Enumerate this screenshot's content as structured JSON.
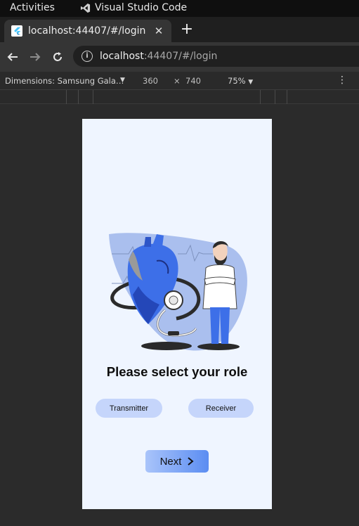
{
  "system_bar": {
    "activities": "Activities",
    "app_name": "Visual Studio Code"
  },
  "tab": {
    "title": "localhost:44407/#/login",
    "close_glyph": "✕"
  },
  "new_tab_glyph": "+",
  "address_bar": {
    "host": "localhost",
    "path": ":44407/#/login"
  },
  "devtools": {
    "device_label": "Dimensions: Samsung Gala…",
    "width": "360",
    "times": "×",
    "height": "740",
    "zoom": "75%"
  },
  "app": {
    "heading": "Please select your role",
    "roles": [
      "Transmitter",
      "Receiver"
    ],
    "next_label": "Next"
  },
  "colors": {
    "page_bg": "#eff5ff",
    "role_button": "#c5d5fb",
    "accent_blue": "#3d6fe8",
    "next_gradient_start": "#a9c4fa",
    "next_gradient_end": "#5b8df2"
  },
  "icons": [
    "vscode-icon",
    "flutter-favicon",
    "back-arrow-icon",
    "forward-arrow-icon",
    "reload-icon",
    "info-icon",
    "chevron-right-icon"
  ]
}
